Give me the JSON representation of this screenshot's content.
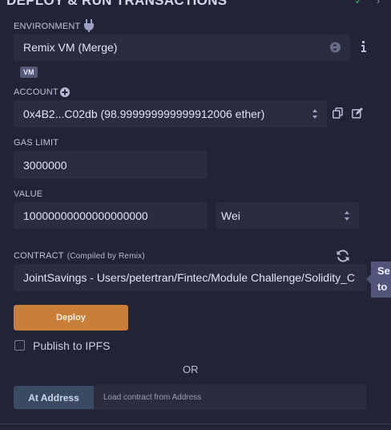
{
  "header": {
    "title": "DEPLOY & RUN TRANSACTIONS"
  },
  "environment": {
    "label": "ENVIRONMENT",
    "value": "Remix VM (Merge)",
    "badge": "VM"
  },
  "account": {
    "label": "ACCOUNT",
    "value": "0x4B2...C02db (98.999999999999912006 ether)"
  },
  "gas_limit": {
    "label": "GAS LIMIT",
    "value": "3000000"
  },
  "value": {
    "label": "VALUE",
    "amount": "10000000000000000000",
    "unit": "Wei"
  },
  "contract": {
    "label": "CONTRACT",
    "sublabel": "(Compiled by Remix)",
    "value": "JointSavings - Users/petertran/Fintec/Module Challenge/Solidity_C"
  },
  "tooltip": {
    "line1": "Se",
    "line2": "to"
  },
  "deploy": {
    "label": "Deploy"
  },
  "ipfs": {
    "label": "Publish to IPFS"
  },
  "or_text": "OR",
  "at_address": {
    "button": "At Address",
    "placeholder": "Load contract from Address"
  }
}
